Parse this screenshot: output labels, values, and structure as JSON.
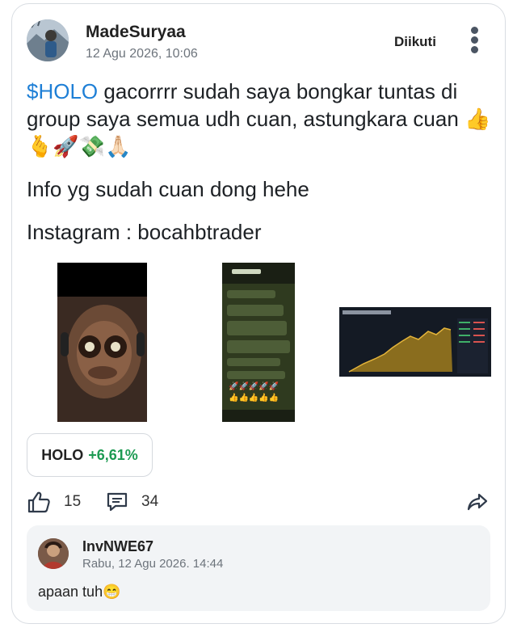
{
  "post": {
    "username": "MadeSuryaa",
    "timestamp": "12 Agu 2026, 10:06",
    "follow_label": "Diikuti",
    "cashtag": "$HOLO",
    "text_1_rest": " gacorrrr sudah saya bongkar tuntas di group saya semua udh cuan, astungkara cuan 👍🫰🚀💸🙏🏻",
    "text_2": "Info yg sudah cuan dong hehe",
    "text_3": "Instagram : bocahbtrader"
  },
  "ticker": {
    "symbol": "HOLO",
    "change": "+6,61%"
  },
  "actions": {
    "likes": "15",
    "comments": "34"
  },
  "reply": {
    "username": "InvNWE67",
    "timestamp": "Rabu, 12 Agu 2026. 14:44",
    "text": "apaan tuh😁"
  },
  "colors": {
    "cashtag": "#1e7fd6",
    "positive": "#1c9a52"
  }
}
